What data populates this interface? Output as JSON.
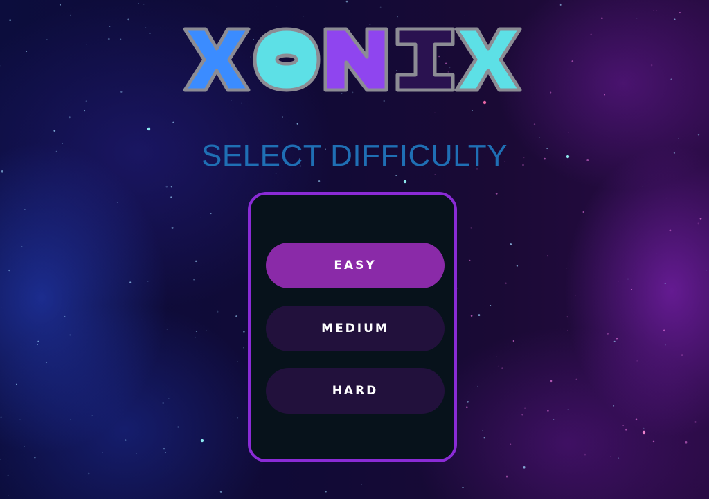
{
  "game": {
    "title": "XONIX",
    "subtitle": "SELECT DIFFICULTY"
  },
  "menu": {
    "options": [
      {
        "label": "EASY",
        "selected": true
      },
      {
        "label": "MEDIUM",
        "selected": false
      },
      {
        "label": "HARD",
        "selected": false
      }
    ]
  },
  "colors": {
    "logo_letters": [
      "#3b8cff",
      "#5de0e6",
      "#8f45ef",
      "#2a1250",
      "#5de0e6"
    ],
    "logo_outline": "#8c8c94",
    "subtitle": "#1f6fb4",
    "panel_border": "#8a2bd6",
    "panel_background": "#07121b",
    "button_selected": "#8a2aa8",
    "button_default": "#22113c"
  }
}
